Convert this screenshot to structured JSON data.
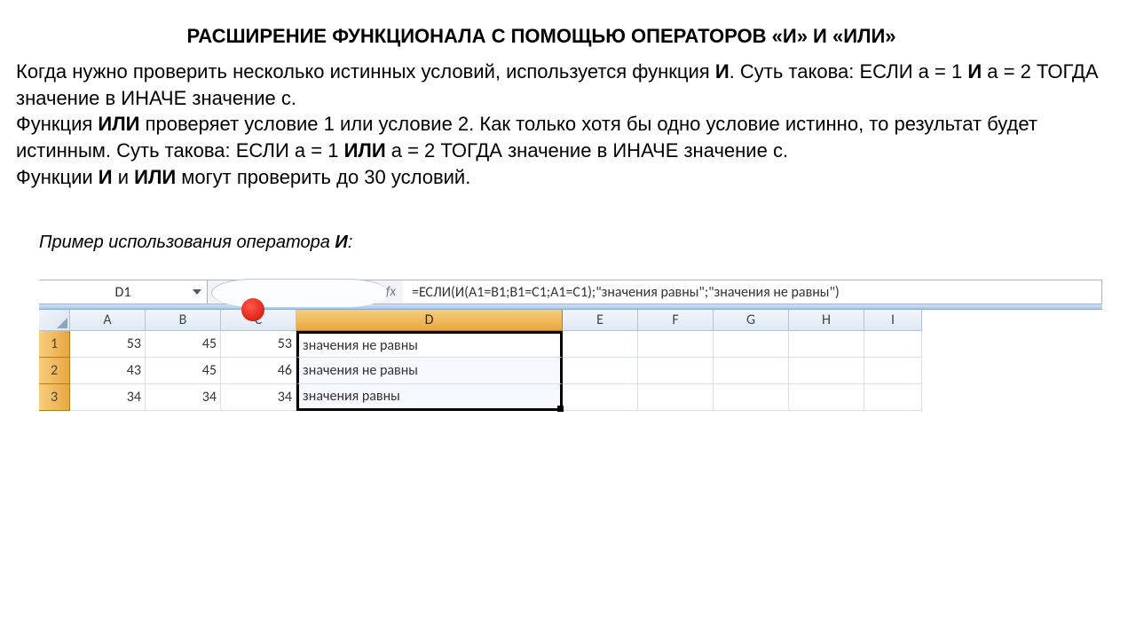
{
  "title": "РАСШИРЕНИЕ ФУНКЦИОНАЛА С ПОМОЩЬЮ ОПЕРАТОРОВ «И» И «ИЛИ»",
  "para": {
    "p1a": "Когда нужно проверить несколько истинных условий, используется функция ",
    "p1b": "И",
    "p1c": ". Суть такова: ЕСЛИ а = 1 ",
    "p1d": "И",
    "p1e": " а = 2 ТОГДА значение в ИНАЧЕ значение с.",
    "p2a": "Функция ",
    "p2b": "ИЛИ",
    "p2c": " проверяет условие 1 или условие 2. Как только хотя бы одно условие истинно, то результат будет истинным. Суть такова: ЕСЛИ а = 1 ",
    "p2d": "ИЛИ",
    "p2e": " а = 2 ТОГДА значение в ИНАЧЕ значение с.",
    "p3a": "Функции ",
    "p3b": "И",
    "p3c": " и ",
    "p3d": "ИЛИ",
    "p3e": " могут проверить до 30 условий."
  },
  "caption": {
    "pre": "Пример использования оператора ",
    "op": "И",
    "post": ":"
  },
  "excel": {
    "nameBox": "D1",
    "fx": "fx",
    "formula": "=ЕСЛИ(И(A1=B1;B1=C1;A1=C1);\"значения равны\";\"значения не равны\")",
    "cols": [
      "A",
      "B",
      "C",
      "D",
      "E",
      "F",
      "G",
      "H",
      "I"
    ],
    "rows": [
      "1",
      "2",
      "3"
    ],
    "data": {
      "A1": "53",
      "B1": "45",
      "C1": "53",
      "D1": "значения не равны",
      "A2": "43",
      "B2": "45",
      "C2": "46",
      "D2": "значения не равны",
      "A3": "34",
      "B3": "34",
      "C3": "34",
      "D3": "значения равны"
    }
  }
}
